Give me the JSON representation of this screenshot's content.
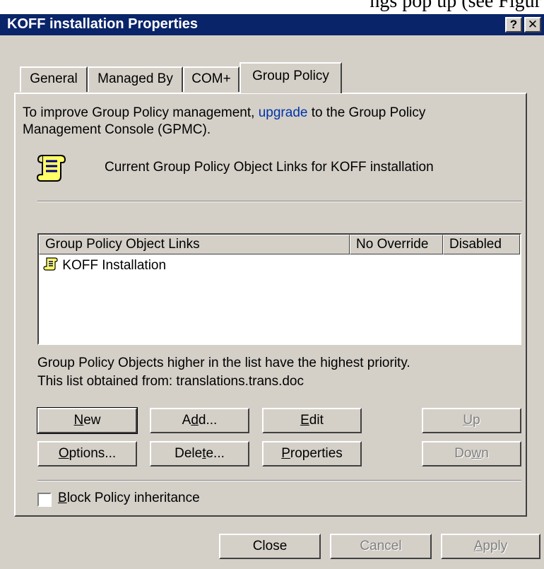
{
  "top_strip_fragment": "ngs pop up (see Figur",
  "window": {
    "title": "KOFF installation Properties",
    "help_glyph": "?",
    "close_glyph": "✕"
  },
  "tabs": [
    {
      "label": "General",
      "active": false
    },
    {
      "label": "Managed By",
      "active": false
    },
    {
      "label": "COM+",
      "active": false
    },
    {
      "label": "Group Policy",
      "active": true
    }
  ],
  "intro": {
    "text_before_link": "To improve Group Policy management, ",
    "link_text": "upgrade",
    "text_after_link": " to the Group Policy Management Console (GPMC)."
  },
  "heading": "Current Group Policy Object Links for KOFF installation",
  "list": {
    "columns": [
      "Group Policy Object Links",
      "No Override",
      "Disabled"
    ],
    "rows": [
      {
        "name": "KOFF Installation",
        "no_override": "",
        "disabled": ""
      }
    ]
  },
  "info": {
    "priority_note": "Group Policy Objects higher in the list have the highest priority.",
    "source_note": "This list obtained from: translations.trans.doc"
  },
  "buttons": {
    "new": {
      "pre": "",
      "key": "N",
      "post": "ew",
      "enabled": true
    },
    "add": {
      "pre": "A",
      "key": "d",
      "post": "d...",
      "enabled": true
    },
    "edit": {
      "pre": "",
      "key": "E",
      "post": "dit",
      "enabled": true
    },
    "up": {
      "pre": "",
      "key": "U",
      "post": "p",
      "enabled": false
    },
    "options": {
      "pre": "",
      "key": "O",
      "post": "ptions...",
      "enabled": true
    },
    "delete": {
      "pre": "Dele",
      "key": "t",
      "post": "e...",
      "enabled": true
    },
    "properties": {
      "pre": "",
      "key": "P",
      "post": "roperties",
      "enabled": true
    },
    "down": {
      "pre": "Do",
      "key": "w",
      "post": "n",
      "enabled": false
    }
  },
  "block_inheritance": {
    "key": "B",
    "rest": "lock Policy inheritance",
    "checked": false
  },
  "footer": {
    "close": {
      "pre": "Close",
      "key": "",
      "post": "",
      "enabled": true
    },
    "cancel": {
      "pre": "Cancel",
      "key": "",
      "post": "",
      "enabled": false
    },
    "apply": {
      "pre": "",
      "key": "A",
      "post": "pply",
      "enabled": false
    }
  },
  "colors": {
    "titlebar": "#0a246a",
    "face": "#d4d0c8",
    "link": "#0033aa",
    "disabled_text": "#808080"
  },
  "icons": {
    "heading_icon": "scroll-icon",
    "row_icon": "gpo-scroll-icon"
  }
}
